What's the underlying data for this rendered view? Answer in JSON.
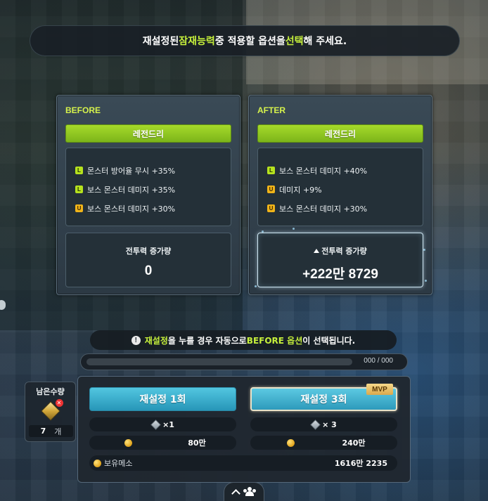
{
  "banner": {
    "part1": "재설정된 ",
    "part2": "잠재능력",
    "part3": " 중 적용할 옵션을 ",
    "part4": "선택",
    "part5": "해 주세요."
  },
  "before": {
    "title": "BEFORE",
    "grade": "레전드리",
    "options": [
      {
        "badge": "L",
        "text": "몬스터 방어율 무시 +35%"
      },
      {
        "badge": "L",
        "text": "보스 몬스터 데미지 +35%"
      },
      {
        "badge": "U",
        "text": "보스 몬스터 데미지 +30%"
      }
    ],
    "power_label": "전투력 증가량",
    "power_value": "0"
  },
  "after": {
    "title": "AFTER",
    "grade": "레전드리",
    "options": [
      {
        "badge": "L",
        "text": "보스 몬스터 데미지 +40%"
      },
      {
        "badge": "U",
        "text": "데미지 +9%"
      },
      {
        "badge": "U",
        "text": "보스 몬스터 데미지 +30%"
      }
    ],
    "power_label": "전투력 증가량",
    "power_value": "+222만 8729"
  },
  "notice": {
    "icon": "!",
    "part1": "재설정",
    "part2": "을 누를 경우 자동으로 ",
    "part3": "BEFORE 옵션",
    "part4": "이 선택됩니다."
  },
  "progress": {
    "text": "000 / 000",
    "fraction": 0
  },
  "remaining": {
    "label": "남은수량",
    "count": "7",
    "unit": "개"
  },
  "actions": {
    "reset1_label": "재설정 1회",
    "reset3_label": "재설정 3회",
    "mvp_badge": "MVP",
    "cube_cost_1": "×1",
    "cube_cost_3": "× 3",
    "meso_cost_1": "80만",
    "meso_cost_3": "240만",
    "owned_meso_label": "보유메소",
    "owned_meso_value": "1616만 2235"
  },
  "colors": {
    "highlight": "#c6f03c",
    "legendary": "#9acc24",
    "button": "#3aaecf",
    "badge_L": "#b6e21e",
    "badge_U": "#f0b419"
  },
  "icons": [
    "warning-icon",
    "cube-icon",
    "meso-coin-icon",
    "chevron-up-icon",
    "people-icon",
    "up-arrow-icon"
  ]
}
